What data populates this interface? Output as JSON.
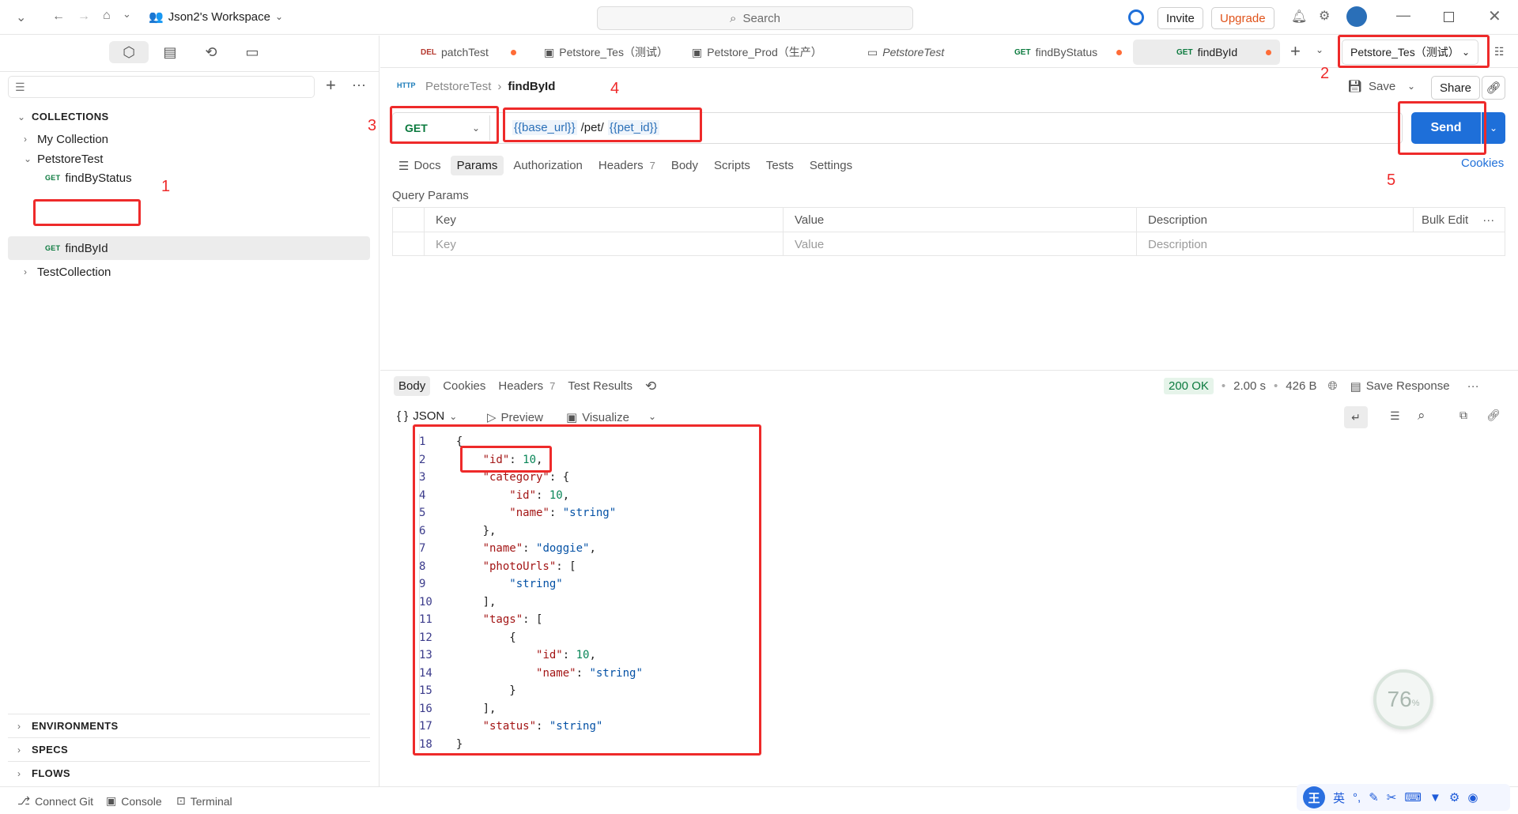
{
  "titlebar": {
    "workspace": "Json2's Workspace",
    "search_placeholder": "Search",
    "invite_label": "Invite",
    "upgrade_label": "Upgrade"
  },
  "sidebar": {
    "collections_heading": "COLLECTIONS",
    "items": [
      {
        "label": "My Collection"
      },
      {
        "label": "PetstoreTest"
      },
      {
        "method": "GET",
        "label": "findByStatus"
      },
      {
        "method": "GET",
        "label": "findById"
      },
      {
        "label": "TestCollection"
      }
    ],
    "bottom_sections": [
      "ENVIRONMENTS",
      "SPECS",
      "FLOWS"
    ]
  },
  "tabs": [
    {
      "method": "DEL",
      "label": "patchTest"
    },
    {
      "label": "Petstore_Tes（测试）"
    },
    {
      "label": "Petstore_Prod（生产）"
    },
    {
      "label": "PetstoreTest"
    },
    {
      "method": "GET",
      "label": "findByStatus"
    },
    {
      "method": "GET",
      "label": "findById"
    }
  ],
  "environment": {
    "selected": "Petstore_Tes（测试）"
  },
  "request": {
    "breadcrumb_parent": "PetstoreTest",
    "breadcrumb_current": "findById",
    "save_label": "Save",
    "share_label": "Share",
    "method": "GET",
    "url_base_var": "{{base_url}}",
    "url_path": "/pet/",
    "url_id_var": "{{pet_id}}",
    "send_label": "Send",
    "cookies_label": "Cookies",
    "sub_tabs": [
      "Docs",
      "Params",
      "Authorization",
      "Headers",
      "Body",
      "Scripts",
      "Tests",
      "Settings"
    ],
    "headers_count": "7",
    "query_params_label": "Query Params",
    "columns": [
      "Key",
      "Value",
      "Description"
    ],
    "bulk_edit": "Bulk Edit",
    "placeholders": {
      "key": "Key",
      "value": "Value",
      "description": "Description"
    }
  },
  "response": {
    "tabs": [
      "Body",
      "Cookies",
      "Headers",
      "Test Results"
    ],
    "headers_count": "7",
    "status": "200 OK",
    "time": "2.00 s",
    "size": "426 B",
    "save_response": "Save Response",
    "format": "JSON",
    "preview": "Preview",
    "visualize": "Visualize",
    "lines": [
      "{",
      "    \"id\": 10,",
      "    \"category\": {",
      "        \"id\": 10,",
      "        \"name\": \"string\"",
      "    },",
      "    \"name\": \"doggie\",",
      "    \"photoUrls\": [",
      "        \"string\"",
      "    ],",
      "    \"tags\": [",
      "        {",
      "            \"id\": 10,",
      "            \"name\": \"string\"",
      "        }",
      "    ],",
      "    \"status\": \"string\"",
      "}"
    ]
  },
  "annotations": [
    "1",
    "2",
    "3",
    "4",
    "5"
  ],
  "progress_badge": {
    "value": "76",
    "unit": "%"
  },
  "statusbar": {
    "connect_git": "Connect Git",
    "console": "Console",
    "terminal": "Terminal"
  },
  "ime": {
    "label": "英"
  }
}
